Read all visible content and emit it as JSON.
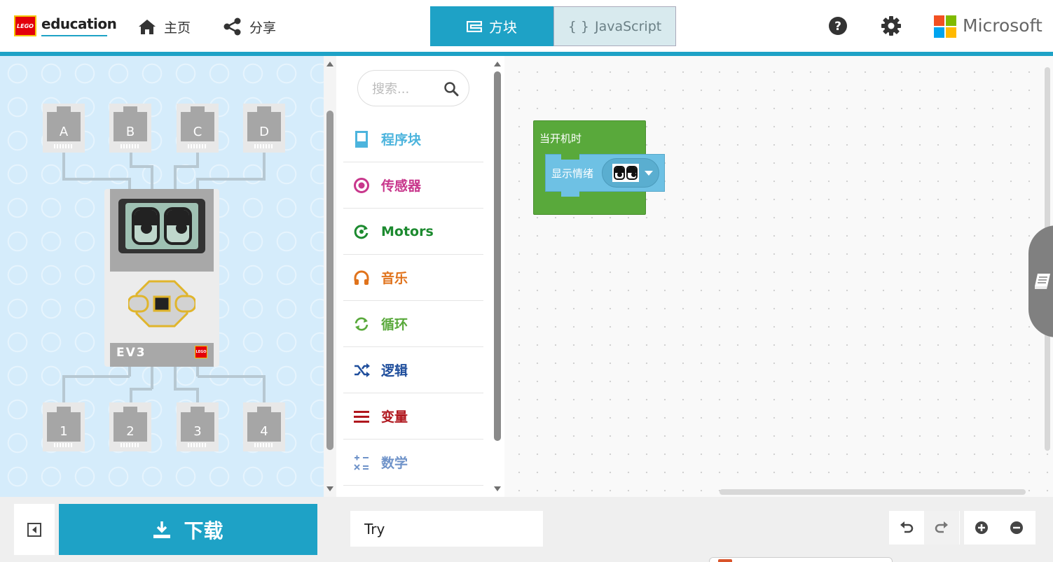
{
  "header": {
    "lego_logo_text": "LEGO",
    "brand_text": "education",
    "nav": {
      "home_label": "主页",
      "share_label": "分享"
    },
    "tabs": {
      "blocks_label": "方块",
      "js_label": "JavaScript",
      "js_icon": "{ }"
    },
    "icons": {
      "help": "help-icon",
      "settings": "gear-icon"
    },
    "microsoft_text": "Microsoft",
    "microsoft_colors": [
      "#f25022",
      "#7fba00",
      "#00a4ef",
      "#ffb900"
    ]
  },
  "simulator": {
    "input_ports": [
      "A",
      "B",
      "C",
      "D"
    ],
    "output_ports": [
      "1",
      "2",
      "3",
      "4"
    ],
    "brick_label": "EV3",
    "brick_logo_text": "LEGO"
  },
  "toolbox": {
    "search_placeholder": "搜索...",
    "categories": [
      {
        "label": "程序块",
        "color": "#4cb4dd",
        "icon": "program-block-icon"
      },
      {
        "label": "传感器",
        "color": "#c8378c",
        "icon": "sensor-icon"
      },
      {
        "label": "Motors",
        "color": "#1c8a2f",
        "icon": "motor-icon"
      },
      {
        "label": "音乐",
        "color": "#e0731c",
        "icon": "headphones-icon"
      },
      {
        "label": "循环",
        "color": "#59a93b",
        "icon": "loop-icon"
      },
      {
        "label": "逻辑",
        "color": "#1f4e9c",
        "icon": "shuffle-icon"
      },
      {
        "label": "变量",
        "color": "#b0171e",
        "icon": "variable-icon"
      },
      {
        "label": "数学",
        "color": "#6f93c9",
        "icon": "math-icon"
      }
    ]
  },
  "workspace": {
    "on_start_label": "当开机时",
    "show_mood_label": "显示情绪",
    "mood_value_icon": "angry-eyes-icon",
    "block_colors": {
      "event": "#59a93b",
      "screen": "#6ec1e4"
    }
  },
  "bottom": {
    "download_label": "下载",
    "project_name": "Try",
    "icons": {
      "collapse": "collapse-simulator-icon",
      "undo": "undo-icon",
      "redo": "redo-icon",
      "zoom_in": "zoom-in-icon",
      "zoom_out": "zoom-out-icon"
    }
  }
}
